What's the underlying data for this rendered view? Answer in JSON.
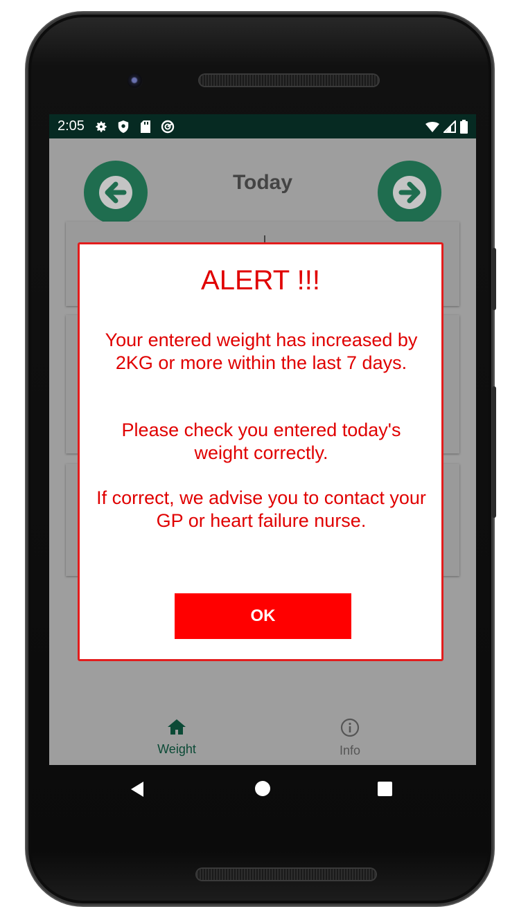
{
  "status_bar": {
    "time": "2:05",
    "left_icons": [
      "gear-icon",
      "shield-icon",
      "sd-card-icon",
      "sync-icon"
    ],
    "right_icons": [
      "wifi-icon",
      "signal-icon",
      "battery-icon"
    ]
  },
  "header": {
    "title": "Today",
    "prev_icon": "arrow-left-icon",
    "next_icon": "arrow-right-icon"
  },
  "dialog": {
    "title": "ALERT !!!",
    "message_1": "Your entered weight has increased by 2KG or more within the last 7 days.",
    "message_2": "Please check you entered today's weight correctly.",
    "message_3": "If correct, we advise you to contact your GP or heart failure nurse.",
    "ok_label": "OK"
  },
  "bottom_nav": {
    "items": [
      {
        "label": "Weight",
        "icon": "home-icon",
        "active": true
      },
      {
        "label": "Info",
        "icon": "info-icon",
        "active": false
      }
    ]
  },
  "colors": {
    "accent_green": "#1f6d4f",
    "alert_red": "#ff0000",
    "status_bar": "#062a22"
  }
}
